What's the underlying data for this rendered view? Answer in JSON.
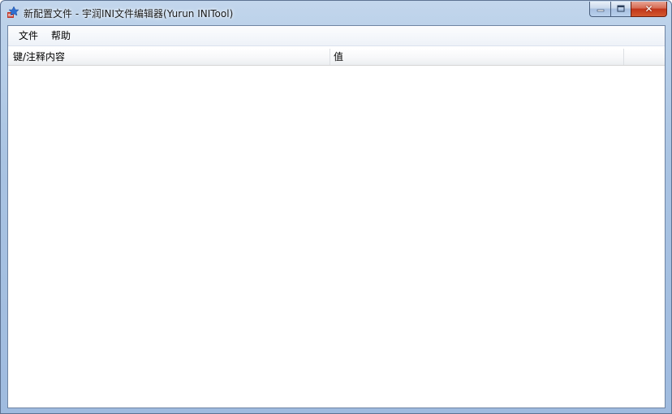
{
  "window": {
    "title": "新配置文件 - 宇润INI文件编辑器(Yurun INITool)",
    "app_icon": "yurun-ini-app-icon"
  },
  "caption_buttons": {
    "minimize_icon": "minimize-icon",
    "maximize_icon": "maximize-icon",
    "close_icon": "close-icon",
    "close_glyph": "✕"
  },
  "menu": {
    "items": [
      {
        "label": "文件"
      },
      {
        "label": "帮助"
      }
    ]
  },
  "list": {
    "columns": [
      {
        "label": "键/注释内容"
      },
      {
        "label": "值"
      },
      {
        "label": ""
      }
    ],
    "rows": []
  },
  "colors": {
    "frame": "#a9c3e2",
    "close_button": "#c2351a",
    "client_background": "#ffffff"
  }
}
